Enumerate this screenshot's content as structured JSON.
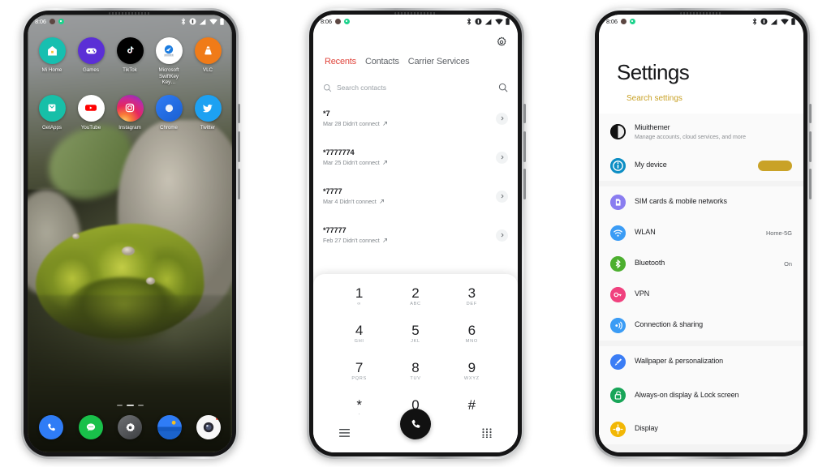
{
  "phones": [
    {
      "id": "home-screen",
      "status_bar": {
        "time": "8:06",
        "icons": [
          "bluetooth-icon",
          "dnd-icon",
          "signal-icon",
          "wifi-icon",
          "battery-icon"
        ],
        "left_dots": [
          "brown-dot",
          "green-dot"
        ]
      },
      "apps_row1": [
        {
          "label": "Mi Home",
          "icon": "mi-home-icon",
          "bg": "#17bfb0"
        },
        {
          "label": "Games",
          "icon": "games-icon",
          "bg": "#5b2fd6"
        },
        {
          "label": "TikTok",
          "icon": "tiktok-icon",
          "bg": "#010101"
        },
        {
          "label": "Microsoft SwiftKey Key…",
          "icon": "swiftkey-icon",
          "bg": "#ffffff"
        },
        {
          "label": "VLC",
          "icon": "vlc-icon",
          "bg": "#f07b18"
        }
      ],
      "apps_row2": [
        {
          "label": "GetApps",
          "icon": "getapps-icon",
          "bg": "#17bfa8"
        },
        {
          "label": "YouTube",
          "icon": "youtube-icon",
          "bg": "#ffffff"
        },
        {
          "label": "Instagram",
          "icon": "instagram-icon",
          "bg": "#d62976"
        },
        {
          "label": "Chrome",
          "icon": "chrome-icon",
          "bg": "#1a73e8"
        },
        {
          "label": "Twitter",
          "icon": "twitter-icon",
          "bg": "#1da1f2"
        }
      ],
      "dock": [
        {
          "name": "phone-icon",
          "bg": "#2f7cf6"
        },
        {
          "name": "messages-icon",
          "bg": "#19c04a"
        },
        {
          "name": "settings-icon",
          "bg": "#4c4c4c"
        },
        {
          "name": "gallery-icon",
          "bg": "#2f7cf6"
        },
        {
          "name": "camera-icon",
          "bg": "#f5f5f5"
        }
      ],
      "page_indicator": {
        "count": 3,
        "active": 1
      }
    },
    {
      "id": "dialer",
      "status_bar": {
        "time": "8:06"
      },
      "gear_label": "settings-gear",
      "tabs": [
        {
          "label": "Recents",
          "active": true
        },
        {
          "label": "Contacts",
          "active": false
        },
        {
          "label": "Carrier Services",
          "active": false
        }
      ],
      "search": {
        "placeholder": "Search contacts"
      },
      "calls": [
        {
          "number": "*7",
          "detail": "Mar 28 Didn't connect"
        },
        {
          "number": "*7777774",
          "detail": "Mar 25 Didn't connect"
        },
        {
          "number": "*7777",
          "detail": "Mar 4 Didn't connect"
        },
        {
          "number": "*77777",
          "detail": "Feb 27 Didn't connect"
        }
      ],
      "keypad": [
        {
          "digit": "1",
          "letters": "∞"
        },
        {
          "digit": "2",
          "letters": "ABC"
        },
        {
          "digit": "3",
          "letters": "DEF"
        },
        {
          "digit": "4",
          "letters": "GHI"
        },
        {
          "digit": "5",
          "letters": "JKL"
        },
        {
          "digit": "6",
          "letters": "MNO"
        },
        {
          "digit": "7",
          "letters": "PQRS"
        },
        {
          "digit": "8",
          "letters": "TUV"
        },
        {
          "digit": "9",
          "letters": "WXYZ"
        },
        {
          "digit": "*",
          "letters": "'"
        },
        {
          "digit": "0",
          "letters": "+"
        },
        {
          "digit": "#",
          "letters": ""
        }
      ],
      "bottom_bar": {
        "menu": "hamburger-menu-icon",
        "call": "call-button-icon",
        "dialpad": "dialpad-grid-icon"
      },
      "accent": "#e0453c"
    },
    {
      "id": "settings",
      "status_bar": {
        "time": "8:06"
      },
      "title": "Settings",
      "search_label": "Search settings",
      "search_color": "#c9a227",
      "groups": [
        {
          "rows": [
            {
              "label": "Miuithemer",
              "sub": "Manage accounts, cloud services, and more",
              "value": "",
              "icon": "account-avatar-icon",
              "bg": "#111111",
              "pill": false
            },
            {
              "label": "My device",
              "sub": "",
              "value": "",
              "icon": "info-icon",
              "bg": "#0d8ec4",
              "pill": true
            }
          ]
        },
        {
          "rows": [
            {
              "label": "SIM cards & mobile networks",
              "sub": "",
              "value": "",
              "icon": "sim-card-icon",
              "bg": "#8a7df0",
              "pill": false
            },
            {
              "label": "WLAN",
              "sub": "",
              "value": "Home-5G",
              "icon": "wifi-icon",
              "bg": "#3b9cf5",
              "pill": false
            },
            {
              "label": "Bluetooth",
              "sub": "",
              "value": "On",
              "icon": "bluetooth-icon",
              "bg": "#4caf2f",
              "pill": false
            },
            {
              "label": "VPN",
              "sub": "",
              "value": "",
              "icon": "vpn-key-icon",
              "bg": "#f0417e",
              "pill": false
            },
            {
              "label": "Connection & sharing",
              "sub": "",
              "value": "",
              "icon": "connection-sharing-icon",
              "bg": "#3b9cf5",
              "pill": false
            }
          ]
        },
        {
          "rows": [
            {
              "label": "Wallpaper & personalization",
              "sub": "",
              "value": "",
              "icon": "brush-icon",
              "bg": "#3b7df5",
              "pill": false
            },
            {
              "label": "Always-on display & Lock screen",
              "sub": "",
              "value": "",
              "icon": "lock-icon",
              "bg": "#18a558",
              "pill": false
            },
            {
              "label": "Display",
              "sub": "",
              "value": "",
              "icon": "display-icon",
              "bg": "#f2b705",
              "pill": false
            }
          ]
        }
      ]
    }
  ]
}
